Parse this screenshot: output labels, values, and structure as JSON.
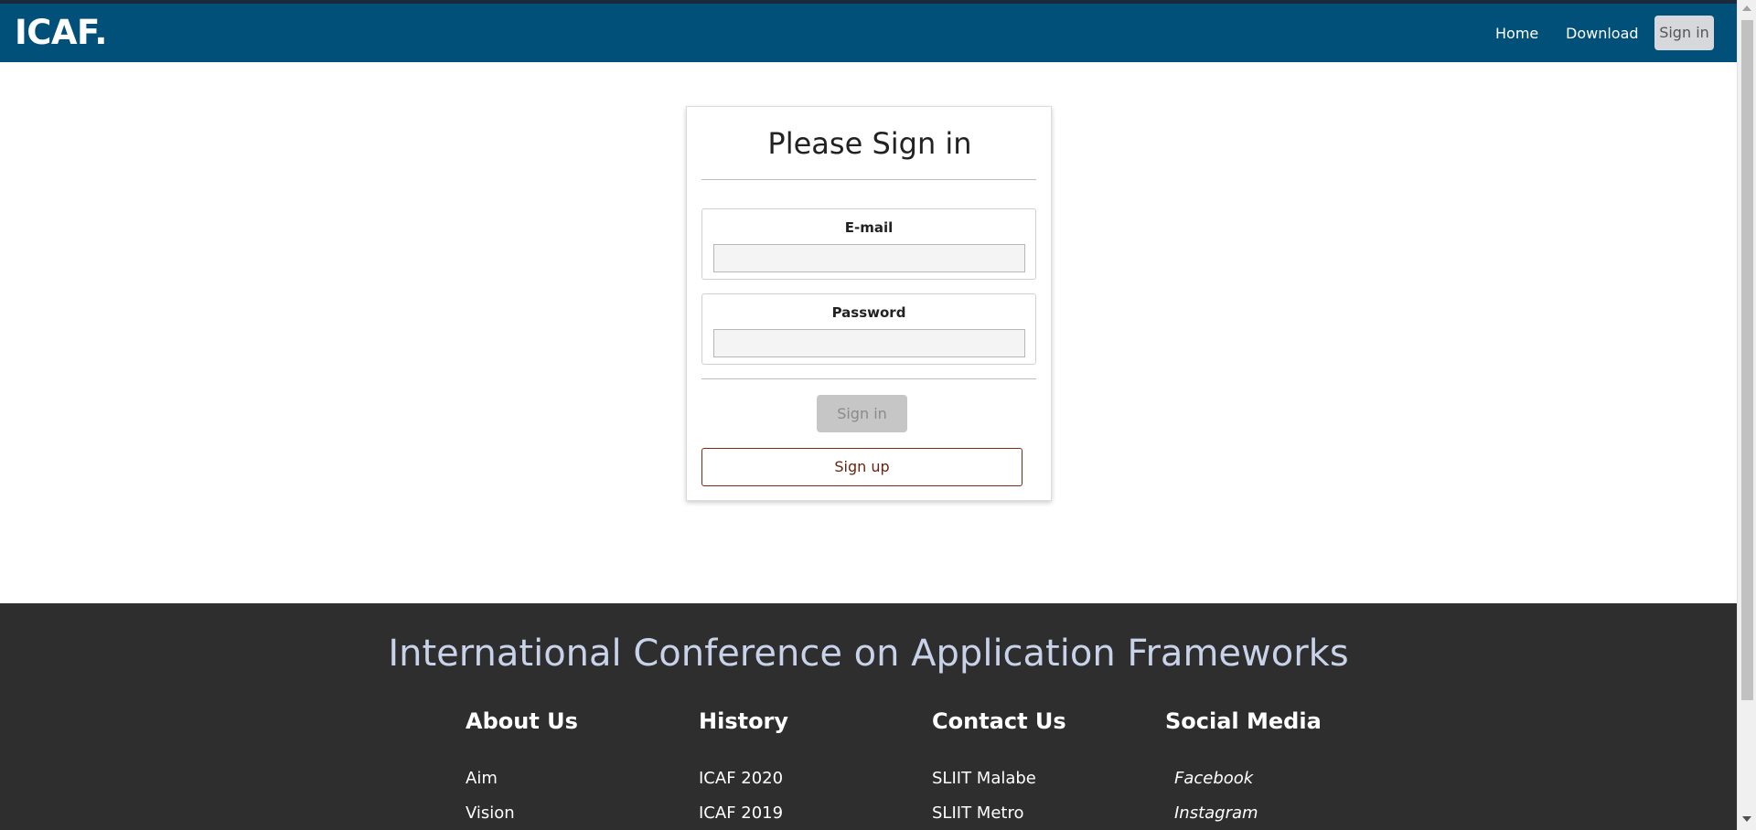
{
  "navbar": {
    "brand": "ICAF.",
    "links": [
      "Home",
      "Download"
    ],
    "signin_label": "Sign in"
  },
  "card": {
    "title": "Please Sign in",
    "email_label": "E-mail",
    "email_value": "",
    "password_label": "Password",
    "password_value": "",
    "signin_label": "Sign in",
    "signup_label": "Sign up"
  },
  "footer": {
    "title": "International Conference on Application Frameworks",
    "columns": [
      {
        "heading": "About Us",
        "items": [
          "Aim",
          "Vision"
        ],
        "italic": false
      },
      {
        "heading": "History",
        "items": [
          "ICAF 2020",
          "ICAF 2019"
        ],
        "italic": false
      },
      {
        "heading": "Contact Us",
        "items": [
          "SLIIT Malabe",
          "SLIIT Metro"
        ],
        "italic": false
      },
      {
        "heading": "Social Media",
        "items": [
          "Facebook",
          "Instagram"
        ],
        "italic": true
      }
    ]
  },
  "colors": {
    "navbar": "#00507a",
    "footer": "#2e2e2e",
    "footer_title": "#c8d3ea",
    "signup_border": "#7a2a12"
  }
}
